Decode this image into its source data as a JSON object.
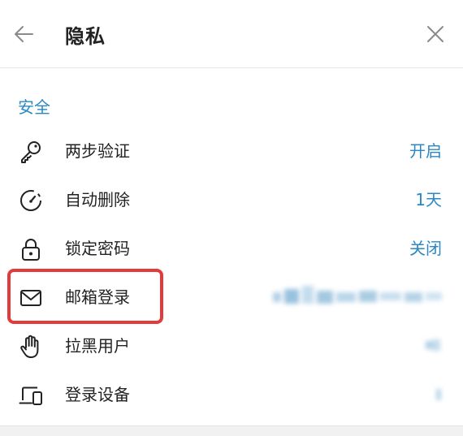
{
  "header": {
    "title": "隐私",
    "back_icon": "arrow-left-icon",
    "close_icon": "close-icon"
  },
  "section": {
    "title": "安全"
  },
  "rows": [
    {
      "name": "two-step-verification",
      "label": "两步验证",
      "value": "开启",
      "icon": "key-icon"
    },
    {
      "name": "auto-delete",
      "label": "自动删除",
      "value": "1天",
      "icon": "timer-icon"
    },
    {
      "name": "passcode-lock",
      "label": "锁定密码",
      "value": "关闭",
      "icon": "lock-icon"
    },
    {
      "name": "email-login",
      "label": "邮箱登录",
      "value": "",
      "icon": "mail-icon"
    },
    {
      "name": "blocked-users",
      "label": "拉黑用户",
      "value": "",
      "icon": "hand-icon"
    },
    {
      "name": "login-devices",
      "label": "登录设备",
      "value": "",
      "icon": "devices-icon"
    }
  ],
  "colors": {
    "accent": "#2a88c4",
    "highlight": "#e33b3b"
  }
}
